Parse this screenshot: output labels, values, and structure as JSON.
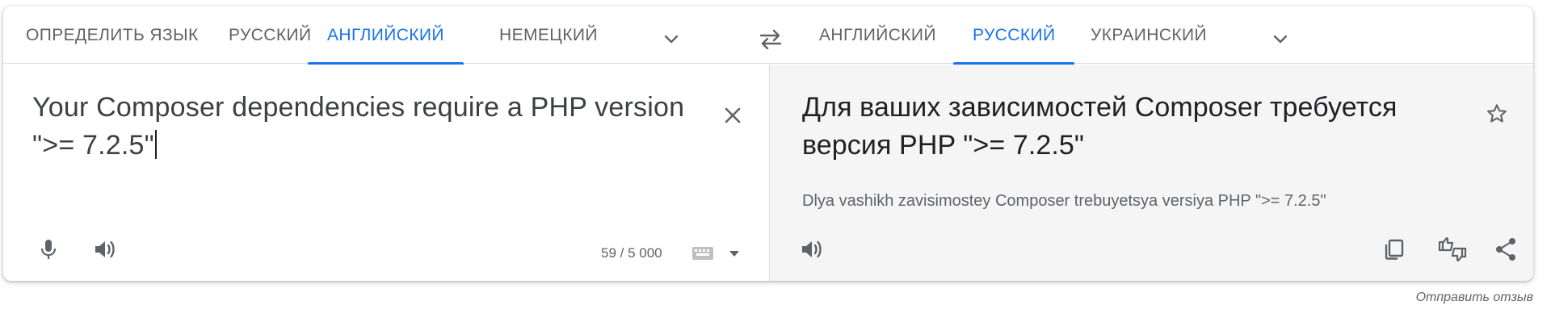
{
  "source_langs": {
    "detect": "ОПРЕДЕЛИТЬ ЯЗЫК",
    "lang1": "РУССКИЙ",
    "lang2": "АНГЛИЙСКИЙ",
    "lang3": "НЕМЕЦКИЙ"
  },
  "target_langs": {
    "lang1": "АНГЛИЙСКИЙ",
    "lang2": "РУССКИЙ",
    "lang3": "УКРАИНСКИЙ"
  },
  "source": {
    "text": "Your Composer dependencies require a PHP version \">= 7.2.5\"",
    "char_count": "59 / 5 000"
  },
  "target": {
    "text": "Для ваших зависимостей Composer требуется версия PHP \">= 7.2.5\"",
    "transliteration": "Dlya vashikh zavisimostey Composer trebuyetsya versiya PHP \">= 7.2.5\""
  },
  "feedback_label": "Отправить отзыв",
  "icons": {
    "chevron": "chevron-down-icon",
    "swap": "swap-arrows-icon",
    "clear": "close-icon",
    "mic": "microphone-icon",
    "speaker": "speaker-icon",
    "keyboard": "keyboard-icon",
    "star": "star-icon",
    "copy": "copy-icon",
    "rate": "thumbs-rate-icon",
    "share": "share-icon"
  },
  "colors": {
    "accent": "#1a73e8",
    "text_primary": "#202124",
    "text_secondary": "#5f6368",
    "target_bg": "#f5f5f5"
  }
}
